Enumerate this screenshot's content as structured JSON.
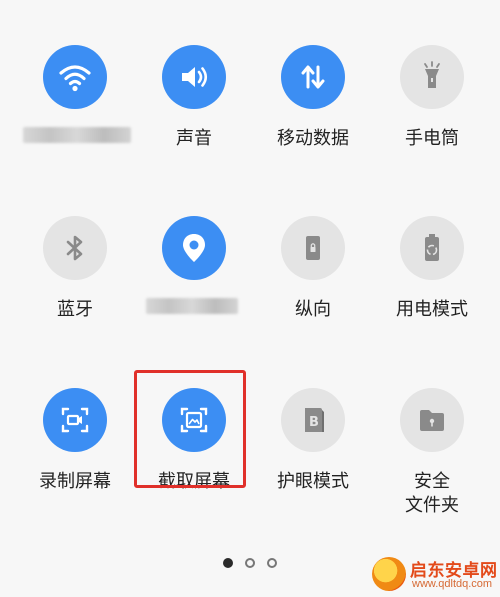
{
  "tiles": [
    {
      "id": "wifi",
      "label": "",
      "state": "on",
      "icon": "wifi-icon"
    },
    {
      "id": "sound",
      "label": "声音",
      "state": "on",
      "icon": "speaker-icon"
    },
    {
      "id": "mobile-data",
      "label": "移动数据",
      "state": "on",
      "icon": "data-arrows-icon"
    },
    {
      "id": "flashlight",
      "label": "手电筒",
      "state": "off",
      "icon": "flashlight-icon"
    },
    {
      "id": "bluetooth",
      "label": "蓝牙",
      "state": "off",
      "icon": "bluetooth-icon"
    },
    {
      "id": "location",
      "label": "",
      "state": "on",
      "icon": "location-pin-icon"
    },
    {
      "id": "portrait",
      "label": "纵向",
      "state": "off",
      "icon": "portrait-lock-icon"
    },
    {
      "id": "power-mode",
      "label": "用电模式",
      "state": "off",
      "icon": "battery-recycle-icon"
    },
    {
      "id": "screen-record",
      "label": "录制屏幕",
      "state": "on",
      "icon": "screen-record-icon"
    },
    {
      "id": "screenshot",
      "label": "截取屏幕",
      "state": "on",
      "icon": "screenshot-icon"
    },
    {
      "id": "eye-comfort",
      "label": "护眼模式",
      "state": "off",
      "icon": "eye-comfort-icon"
    },
    {
      "id": "safe",
      "label": "安全\n文件夹",
      "state": "off",
      "icon": "secure-folder-icon"
    }
  ],
  "pagination": {
    "pages": 3,
    "current": 1
  },
  "highlight": {
    "target": "screenshot",
    "color": "#e0302a"
  },
  "watermark": {
    "title": "启东安卓网",
    "url": "www.qdltdq.com"
  },
  "colors": {
    "active": "#3c8ef3",
    "inactive": "#e4e4e4",
    "background": "#f7f7f7"
  }
}
